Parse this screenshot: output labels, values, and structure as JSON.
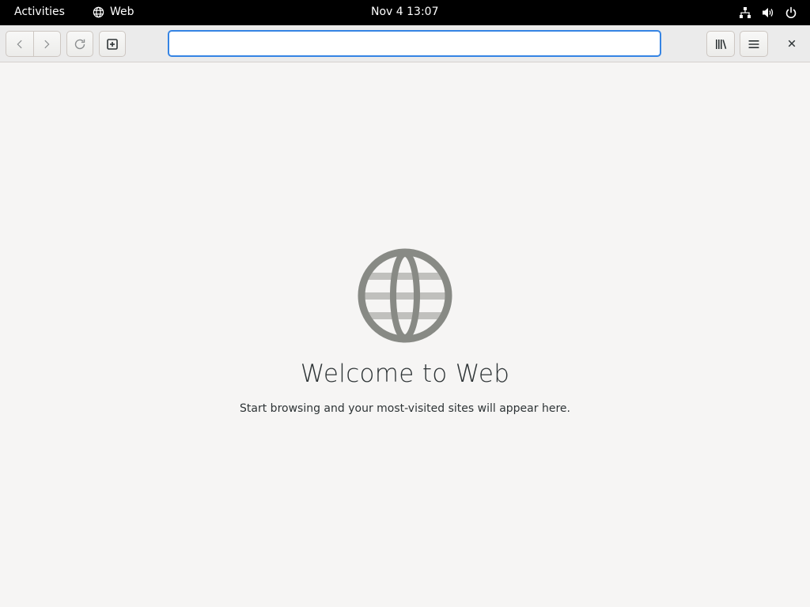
{
  "topbar": {
    "activities_label": "Activities",
    "app_name": "Web",
    "clock": "Nov 4  13:07",
    "status_icons": [
      "network-icon",
      "volume-icon",
      "power-icon"
    ]
  },
  "toolbar": {
    "back_icon": "chevron-left-icon",
    "forward_icon": "chevron-right-icon",
    "reload_icon": "reload-icon",
    "new_tab_icon": "new-tab-icon",
    "library_icon": "library-icon",
    "menu_icon": "hamburger-menu-icon",
    "close_icon": "close-icon"
  },
  "address_bar": {
    "value": "",
    "placeholder": ""
  },
  "welcome": {
    "title": "Welcome to Web",
    "subtitle": "Start browsing and your most-visited sites will appear here."
  },
  "colors": {
    "accent": "#3584e4",
    "topbar_bg": "#000000",
    "window_bg": "#f6f5f4",
    "globe": "#888a85"
  }
}
